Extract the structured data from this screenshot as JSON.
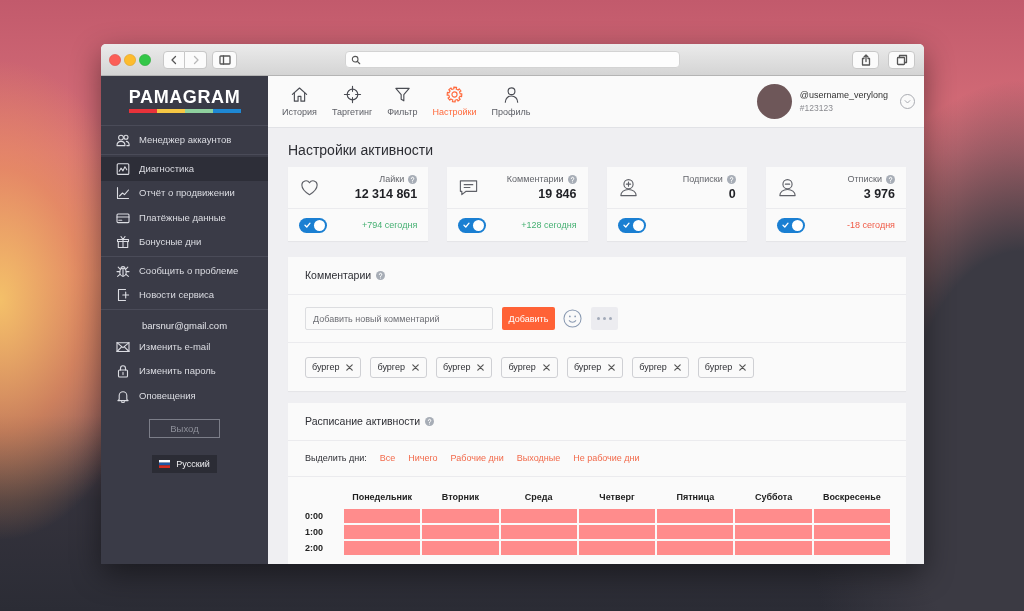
{
  "browser": {
    "back": {
      "disabled": false
    },
    "forward": {
      "disabled": true
    }
  },
  "sidebar": {
    "logo": "PAMAGRAM",
    "sections": [
      {
        "items": [
          {
            "label": "Менеджер аккаунтов",
            "selected": false
          }
        ]
      },
      {
        "items": [
          {
            "label": "Диагностика",
            "selected": true
          },
          {
            "label": "Отчёт о продвижении",
            "selected": false
          },
          {
            "label": "Платёжные данные",
            "selected": false
          },
          {
            "label": "Бонусные дни",
            "selected": false
          }
        ]
      },
      {
        "items": [
          {
            "label": "Сообщить о проблеме",
            "selected": false
          },
          {
            "label": "Новости сервиса",
            "selected": false
          }
        ]
      }
    ],
    "account": {
      "email": "barsnur@gmail.com",
      "items": [
        {
          "label": "Изменить e-mail",
          "selected": false
        },
        {
          "label": "Изменить пароль",
          "selected": false
        },
        {
          "label": "Оповещения",
          "selected": false
        }
      ]
    },
    "logout_button": "Выход",
    "language": "Русский"
  },
  "nav": {
    "items": [
      {
        "label": "История",
        "selected": false
      },
      {
        "label": "Таргетинг",
        "selected": false
      },
      {
        "label": "Фильтр",
        "selected": false
      },
      {
        "label": "Настройки",
        "selected": true
      },
      {
        "label": "Профиль",
        "selected": false
      }
    ]
  },
  "user": {
    "username": "@username_verylong",
    "id": "#123123"
  },
  "page_title": "Настройки активности",
  "stats": [
    {
      "label": "Лайки",
      "value": "12 314 861",
      "enabled": true,
      "today": "+794 сегодня",
      "kind": "gain"
    },
    {
      "label": "Комментарии",
      "value": "19 846",
      "enabled": true,
      "today": "+128 сегодня",
      "kind": "gain"
    },
    {
      "label": "Подписки",
      "value": "0",
      "enabled": true
    },
    {
      "label": "Отписки",
      "value": "3 976",
      "enabled": true,
      "today": "-18 сегодня",
      "kind": "loss"
    }
  ],
  "comments": {
    "title": "Комментарии",
    "input": {
      "placeholder": "Добавить новый комментарий"
    },
    "add_button": "Добавить",
    "tags": [
      {
        "label": "бургер"
      },
      {
        "label": "бургер"
      },
      {
        "label": "бургер"
      },
      {
        "label": "бургер"
      },
      {
        "label": "бургер"
      },
      {
        "label": "бургер"
      },
      {
        "label": "бургер"
      }
    ]
  },
  "schedule": {
    "title": "Расписание активности",
    "select_label": "Выделить дни:",
    "select_links": [
      "Все",
      "Ничего",
      "Рабочие дни",
      "Выходные",
      "Не рабочие дни"
    ],
    "days": [
      "Понедельник",
      "Вторник",
      "Среда",
      "Четверг",
      "Пятница",
      "Суббота",
      "Воскресенье"
    ],
    "rows": [
      {
        "time": "0:00",
        "cells": [
          {
            "selected": true
          },
          {
            "selected": true
          },
          {
            "selected": true
          },
          {
            "selected": true
          },
          {
            "selected": true
          },
          {
            "selected": true
          },
          {
            "selected": true
          }
        ]
      },
      {
        "time": "1:00",
        "cells": [
          {
            "selected": true
          },
          {
            "selected": true
          },
          {
            "selected": true
          },
          {
            "selected": true
          },
          {
            "selected": true
          },
          {
            "selected": true
          },
          {
            "selected": true
          }
        ]
      },
      {
        "time": "2:00",
        "cells": [
          {
            "selected": true
          },
          {
            "selected": true
          },
          {
            "selected": true
          },
          {
            "selected": true
          },
          {
            "selected": true
          },
          {
            "selected": true
          },
          {
            "selected": true
          }
        ]
      }
    ]
  }
}
